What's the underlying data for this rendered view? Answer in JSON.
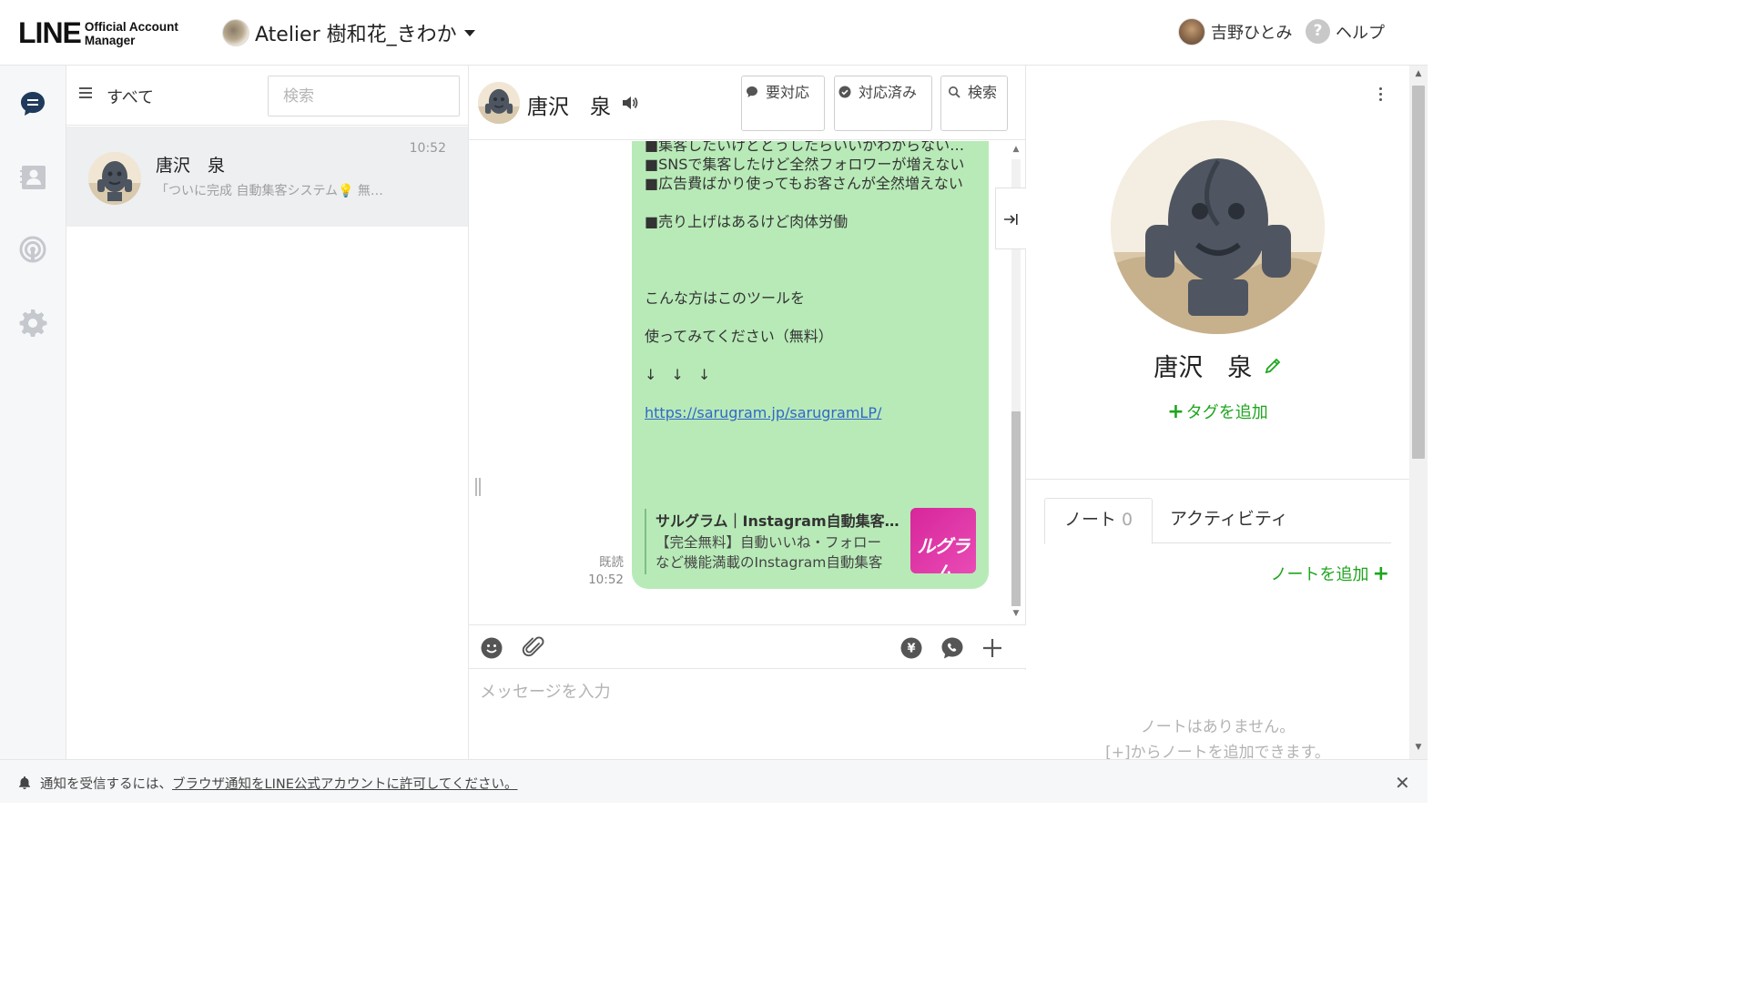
{
  "header": {
    "logo_main": "LINE",
    "logo_sub_1": "Official Account",
    "logo_sub_2": "Manager",
    "account_name": "Atelier 樹和花_きわか",
    "user_name": "吉野ひとみ",
    "help_label": "ヘルプ"
  },
  "chat_list": {
    "filter_label": "すべて",
    "search_placeholder": "検索",
    "items": [
      {
        "name": "唐沢　泉",
        "time": "10:52",
        "preview": "「ついに完成 自動集客システム💡 無料..."
      }
    ]
  },
  "conversation": {
    "contact_name": "唐沢　泉",
    "buttons": {
      "needs_action": "要対応",
      "resolved": "対応済み",
      "search": "検索"
    },
    "message": {
      "lines": [
        "■集客したいけどどうしたらいいかわからない…",
        "■SNSで集客したけど全然フォロワーが増えない",
        "■広告費ばかり使ってもお客さんが全然増えない",
        "",
        "■売り上げはあるけど肉体労働",
        "",
        "",
        "",
        "こんな方はこのツールを",
        "",
        "使ってみてください（無料）",
        "",
        "↓　↓　↓",
        ""
      ],
      "link": "https://sarugram.jp/sarugramLP/",
      "og_title": "サルグラム｜Instagram自動集客ツール",
      "og_description": "【完全無料】自動いいね・フォローなど機能満載のInstagram自動集客ツール",
      "og_thumb_text": "ルグラム",
      "read_label": "既読",
      "time": "10:52"
    },
    "compose_placeholder": "メッセージを入力"
  },
  "profile": {
    "name": "唐沢　泉",
    "add_tag_label": "タグを追加",
    "tabs": [
      {
        "label": "ノート",
        "count": "0"
      },
      {
        "label": "アクティビティ"
      }
    ],
    "add_note_label": "ノートを追加",
    "empty_line_1": "ノートはありません。",
    "empty_line_2": "[+]からノートを追加できます。"
  },
  "notification": {
    "text": "通知を受信するには、",
    "link_text": "ブラウザ通知をLINE公式アカウントに許可してください。"
  },
  "colors": {
    "accent_green": "#1ea61e",
    "bubble_green": "#b8eab8",
    "link_blue": "#3268c7"
  }
}
